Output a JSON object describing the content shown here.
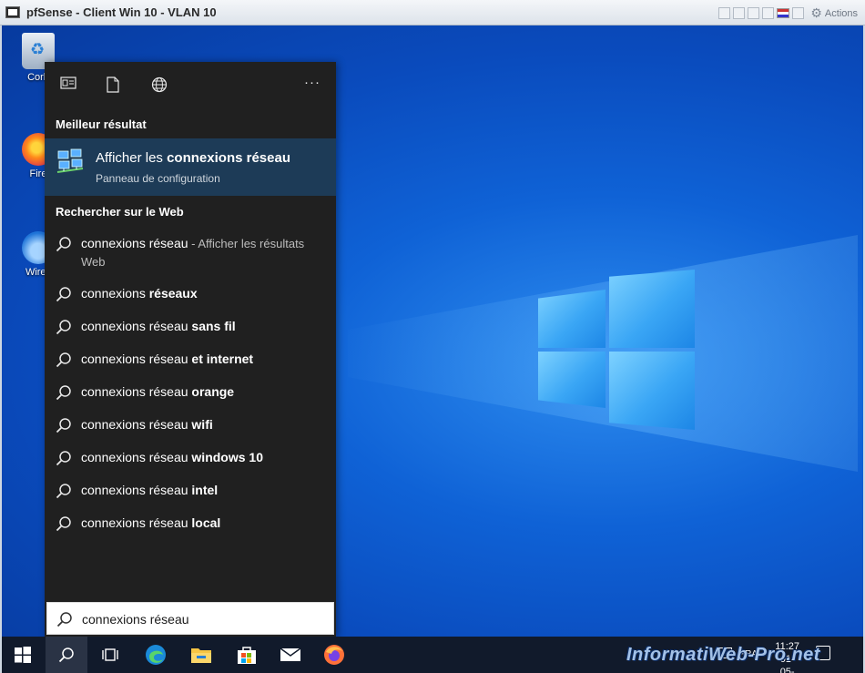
{
  "vm_window": {
    "title": "pfSense - Client Win 10 - VLAN 10",
    "actions_label": "Actions"
  },
  "desktop": {
    "icons": [
      {
        "label": "Corb",
        "icon": "recycle-bin-icon"
      },
      {
        "label": "Fire",
        "icon": "firefox-icon"
      },
      {
        "label": "Wires",
        "icon": "wireshark-icon"
      }
    ]
  },
  "search_panel": {
    "header_icons": [
      "apps-icon",
      "document-icon",
      "web-icon",
      "more-options-icon"
    ],
    "more_label": "···",
    "best_result_heading": "Meilleur résultat",
    "best_result": {
      "title_prefix": "Afficher les ",
      "title_bold": "connexions réseau",
      "subtitle": "Panneau de configuration",
      "icon": "network-connections-icon"
    },
    "web_heading": "Rechercher sur le Web",
    "first_suggestion": {
      "text": "connexions réseau",
      "suffix": " - Afficher les résultats",
      "suffix_line2": "Web"
    },
    "suggestions": [
      {
        "prefix": "connexions ",
        "bold": "réseaux"
      },
      {
        "prefix": "connexions réseau ",
        "bold": "sans fil"
      },
      {
        "prefix": "connexions réseau ",
        "bold": "et internet"
      },
      {
        "prefix": "connexions réseau ",
        "bold": "orange"
      },
      {
        "prefix": "connexions réseau ",
        "bold": "wifi"
      },
      {
        "prefix": "connexions réseau ",
        "bold": "windows 10"
      },
      {
        "prefix": "connexions réseau ",
        "bold": "intel"
      },
      {
        "prefix": "connexions réseau ",
        "bold": "local"
      }
    ]
  },
  "search_box": {
    "value": "connexions réseau"
  },
  "taskbar": {
    "items": [
      "start-icon",
      "search-icon",
      "task-view-icon",
      "edge-icon",
      "file-explorer-icon",
      "store-icon",
      "mail-icon",
      "firefox-icon"
    ],
    "language": "FRA",
    "time": "11:27",
    "date": "01-05-23"
  },
  "watermark": "InformatiWeb-Pro.net",
  "colors": {
    "panel_bg": "#202020",
    "best_result_bg": "#1d3b57",
    "taskbar_bg": "#111a2b",
    "desktop_blue": "#0f62d6"
  }
}
